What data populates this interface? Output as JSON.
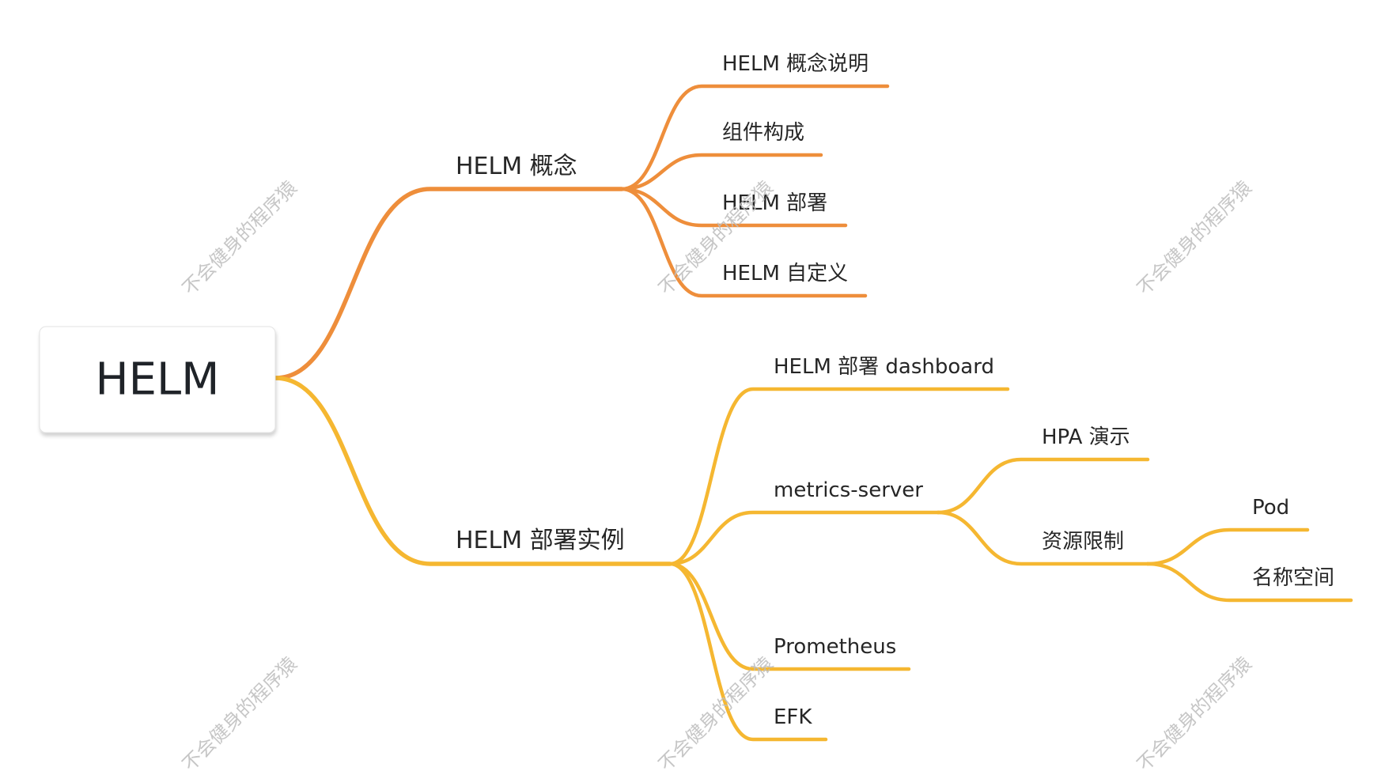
{
  "mindmap": {
    "root": {
      "label": "HELM"
    },
    "branches": [
      {
        "label": "HELM 概念",
        "children": [
          {
            "label": "HELM 概念说明"
          },
          {
            "label": "组件构成"
          },
          {
            "label": "HELM 部署"
          },
          {
            "label": "HELM 自定义"
          }
        ]
      },
      {
        "label": "HELM 部署实例",
        "children": [
          {
            "label": "HELM 部署 dashboard"
          },
          {
            "label": "metrics-server",
            "children": [
              {
                "label": "HPA 演示"
              },
              {
                "label": "资源限制",
                "children": [
                  {
                    "label": "Pod"
                  },
                  {
                    "label": "名称空间"
                  }
                ]
              }
            ]
          },
          {
            "label": "Prometheus"
          },
          {
            "label": "EFK"
          }
        ]
      }
    ]
  },
  "watermark": {
    "text": "不会健身的程序猿"
  },
  "colors": {
    "branch_1": "#EE8E3B",
    "branch_2": "#F5B731",
    "text": "#262626",
    "watermark": "#bdbdbd",
    "background": "#ffffff"
  }
}
